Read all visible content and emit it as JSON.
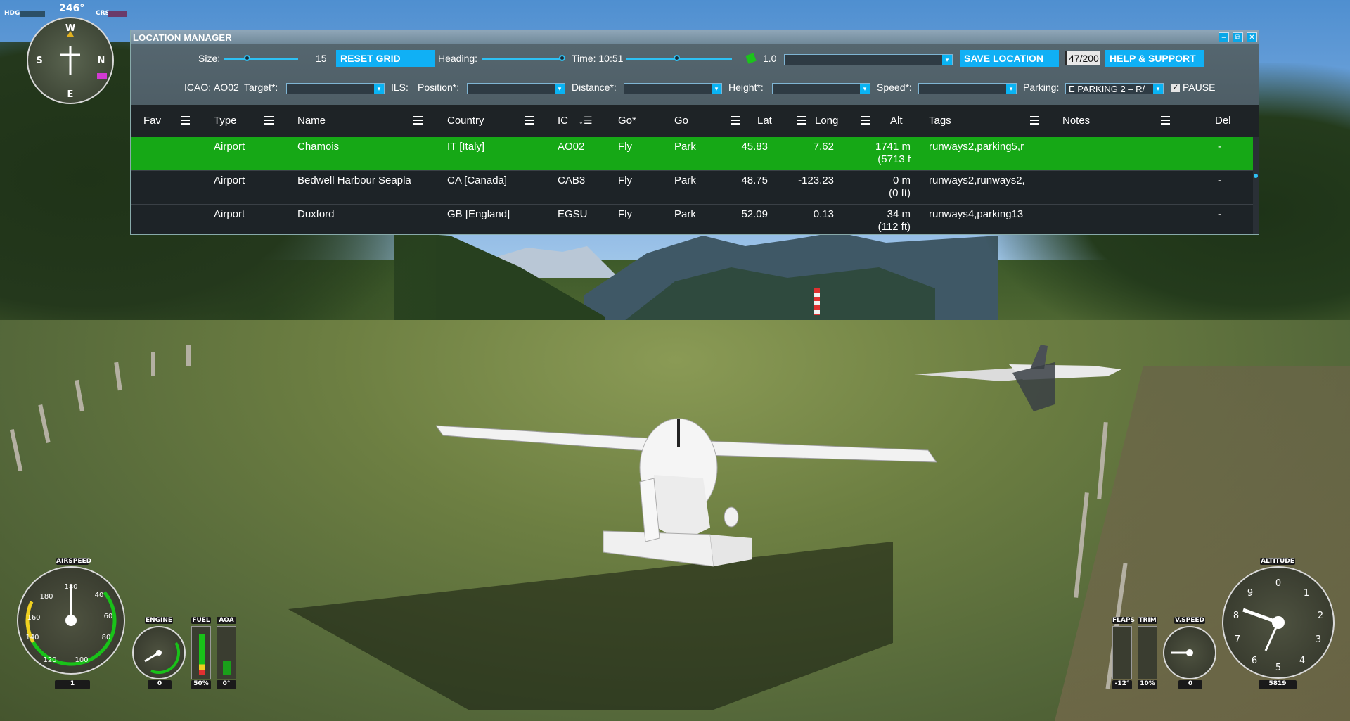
{
  "window": {
    "title": "LOCATION MANAGER",
    "controls": [
      "–",
      "⧉",
      "✕"
    ]
  },
  "toolbar": {
    "size_label": "Size:",
    "size_value": "15",
    "reset_grid": "RESET GRID",
    "heading_label": "Heading:",
    "time_label": "Time: 10:51",
    "rate_value": "1.0",
    "save_location": "SAVE LOCATION",
    "count": "47/200",
    "help_support": "HELP & SUPPORT",
    "icao_label": "ICAO:",
    "icao_value": "AO02",
    "target_label": "Target*:",
    "ils_label": "ILS:",
    "position_label": "Position*:",
    "distance_label": "Distance*:",
    "height_label": "Height*:",
    "speed_label": "Speed*:",
    "parking_label": "Parking:",
    "parking_value": "E PARKING 2 – R/",
    "pause_label": "PAUSE",
    "pause_checked": "✓"
  },
  "table": {
    "headers": {
      "fav": "Fav",
      "type": "Type",
      "name": "Name",
      "country": "Country",
      "icao": "IC",
      "go_star": "Go*",
      "go": "Go",
      "lat": "Lat",
      "long": "Long",
      "alt": "Alt",
      "tags": "Tags",
      "notes": "Notes",
      "del": "Del"
    },
    "rows": [
      {
        "type": "Airport",
        "name": "Chamois",
        "country": "IT [Italy]",
        "icao": "AO02",
        "go_star": "Fly",
        "go": "Park",
        "lat": "45.83",
        "long": "7.62",
        "alt_m": "1741 m",
        "alt_ft": "(5713 f",
        "tags": "runways2,parking5,r",
        "notes": "",
        "del": "-"
      },
      {
        "type": "Airport",
        "name": "Bedwell Harbour Seapla",
        "country": "CA [Canada]",
        "icao": "CAB3",
        "go_star": "Fly",
        "go": "Park",
        "lat": "48.75",
        "long": "-123.23",
        "alt_m": "0 m",
        "alt_ft": "(0 ft)",
        "tags": "runways2,runways2,",
        "notes": "",
        "del": "-"
      },
      {
        "type": "Airport",
        "name": "Duxford",
        "country": "GB [England]",
        "icao": "EGSU",
        "go_star": "Fly",
        "go": "Park",
        "lat": "52.09",
        "long": "0.13",
        "alt_m": "34 m",
        "alt_ft": "(112 ft)",
        "tags": "runways4,parking13",
        "notes": "",
        "del": "-"
      }
    ]
  },
  "hud": {
    "heading_value": "246°",
    "hdg_label": "HDG",
    "crs_label": "CRS",
    "airspeed_label": "AIRSPEED",
    "airspeed_readout": "1",
    "engine_label": "ENGINE",
    "engine_readout": "0",
    "fuel_label": "FUEL",
    "fuel_readout": "50%",
    "aoa_label": "AOA",
    "aoa_readout": "0°",
    "flaps_label": "FLAPS",
    "flaps_readout": "-12°",
    "trim_label": "TRIM",
    "trim_readout": "10%",
    "vspeed_label": "V.SPEED",
    "vspeed_readout": "0",
    "altitude_label": "ALTITUDE",
    "altitude_readout": "5819"
  }
}
